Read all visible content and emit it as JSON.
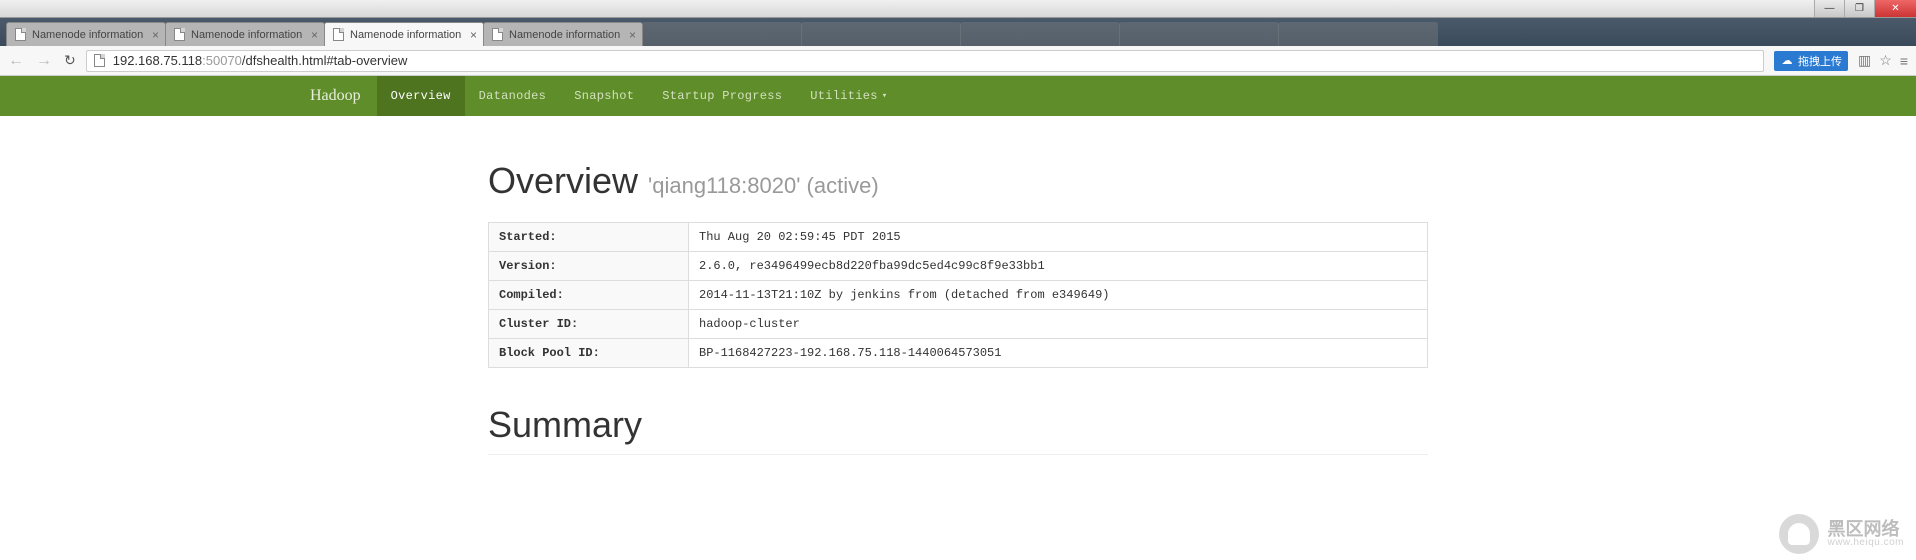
{
  "os": {
    "min": "—",
    "max": "❐",
    "close": "✕"
  },
  "browser": {
    "tabs": [
      {
        "title": "Namenode information"
      },
      {
        "title": "Namenode information"
      },
      {
        "title": "Namenode information"
      },
      {
        "title": "Namenode information"
      }
    ],
    "url_host": "192.168.75.118",
    "url_port": ":50070",
    "url_path": "/dfshealth.html#tab-overview",
    "ext_label": "拖拽上传"
  },
  "nav": {
    "brand": "Hadoop",
    "items": [
      "Overview",
      "Datanodes",
      "Snapshot",
      "Startup Progress",
      "Utilities"
    ]
  },
  "overview": {
    "heading": "Overview",
    "sub": "'qiang118:8020' (active)"
  },
  "table": {
    "rows": [
      {
        "k": "Started:",
        "v": "Thu Aug 20 02:59:45 PDT 2015"
      },
      {
        "k": "Version:",
        "v": "2.6.0, re3496499ecb8d220fba99dc5ed4c99c8f9e33bb1"
      },
      {
        "k": "Compiled:",
        "v": "2014-11-13T21:10Z by jenkins from (detached from e349649)"
      },
      {
        "k": "Cluster ID:",
        "v": "hadoop-cluster"
      },
      {
        "k": "Block Pool ID:",
        "v": "BP-1168427223-192.168.75.118-1440064573051"
      }
    ]
  },
  "summary_heading": "Summary",
  "watermark": {
    "cn": "黑区网络",
    "en": "www.heiqu.com"
  }
}
